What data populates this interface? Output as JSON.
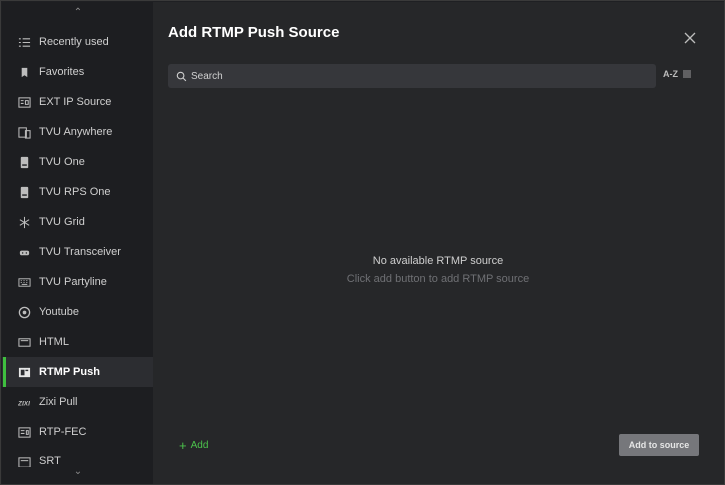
{
  "dialog": {
    "title": "Add RTMP Push Source",
    "close_icon": "close-icon"
  },
  "search": {
    "placeholder": "Search",
    "value": ""
  },
  "sort": {
    "label": "A-Z",
    "icon": "list-sort-icon"
  },
  "empty_state": {
    "title": "No available RTMP source",
    "subtitle": "Click add button to add RTMP source"
  },
  "footer": {
    "add_label": "Add",
    "add_to_source_label": "Add to source"
  },
  "sidebar": {
    "items": [
      {
        "label": "Recently used",
        "icon": "recent-list-icon"
      },
      {
        "label": "Favorites",
        "icon": "bookmark-icon"
      },
      {
        "label": "EXT IP Source",
        "icon": "ext-ip-icon"
      },
      {
        "label": "TVU Anywhere",
        "icon": "devices-icon"
      },
      {
        "label": "TVU One",
        "icon": "tvu-one-icon"
      },
      {
        "label": "TVU RPS One",
        "icon": "tvu-rps-icon"
      },
      {
        "label": "TVU Grid",
        "icon": "grid-star-icon"
      },
      {
        "label": "TVU Transceiver",
        "icon": "transceiver-icon"
      },
      {
        "label": "TVU Partyline",
        "icon": "keyboard-icon"
      },
      {
        "label": "Youtube",
        "icon": "youtube-icon"
      },
      {
        "label": "HTML",
        "icon": "html-icon"
      },
      {
        "label": "RTMP Push",
        "icon": "rtmp-icon",
        "active": true
      },
      {
        "label": "Zixi Pull",
        "icon": "zixi-icon"
      },
      {
        "label": "RTP-FEC",
        "icon": "rtp-icon"
      },
      {
        "label": "SRT",
        "icon": "srt-icon"
      }
    ]
  },
  "colors": {
    "accent": "#3fbf3f",
    "add_green": "#4cc34c",
    "panel": "#262729",
    "sidebar": "#1d1e21"
  }
}
